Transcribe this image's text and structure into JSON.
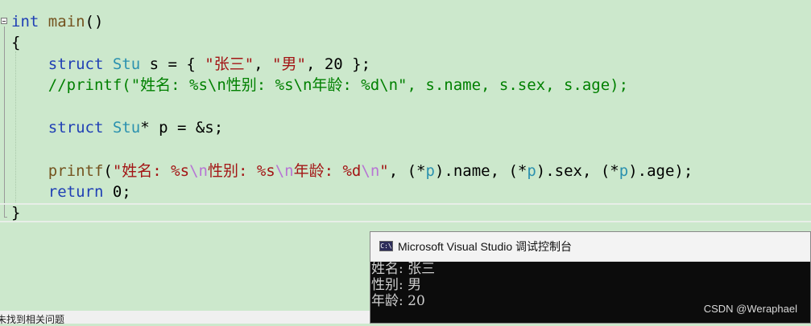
{
  "editor": {
    "lines": {
      "l1": {
        "kw": "int",
        "fn": "main",
        "rest": "()"
      },
      "l2": {
        "text": "{"
      },
      "l3": {
        "kw": "struct",
        "ty": "Stu",
        "a": " s = { ",
        "s1": "\"张三\"",
        "b": ", ",
        "s2": "\"男\"",
        "c": ", 20 };"
      },
      "l4": {
        "comment": "//printf(\"姓名: %s\\n性别: %s\\n年龄: %d\\n\", s.name, s.sex, s.age);"
      },
      "l5": {
        "kw": "struct",
        "ty": "Stu",
        "rest": "* p = &s;"
      },
      "l6": {
        "fn": "printf",
        "p1": "(",
        "s1": "\"姓名: %s",
        "e1": "\\n",
        "s2": "性别: %s",
        "e2": "\\n",
        "s3": "年龄: %d",
        "e3": "\\n",
        "s4": "\"",
        "r1": ", (*",
        "v1": "p",
        "r2": ").name, (*",
        "v2": "p",
        "r3": ").sex, (*",
        "v3": "p",
        "r4": ").age);"
      },
      "l7": {
        "kw": "return",
        "rest": " 0;"
      },
      "l8": {
        "text": "}"
      }
    }
  },
  "console": {
    "icon": "C:\\",
    "title": "Microsoft Visual Studio 调试控制台",
    "output": [
      "姓名: 张三",
      "性别: 男",
      "年龄: 20"
    ],
    "watermark": "CSDN @Weraphael"
  },
  "status": {
    "text": "未找到相关问题"
  },
  "colors": {
    "editor_bg": "#cce8cc",
    "keyword": "#1f3fb5",
    "type": "#2b91af",
    "function": "#74531f",
    "string": "#a31515",
    "comment": "#008000",
    "escape": "#b775d4",
    "console_bg": "#0c0c0c"
  }
}
